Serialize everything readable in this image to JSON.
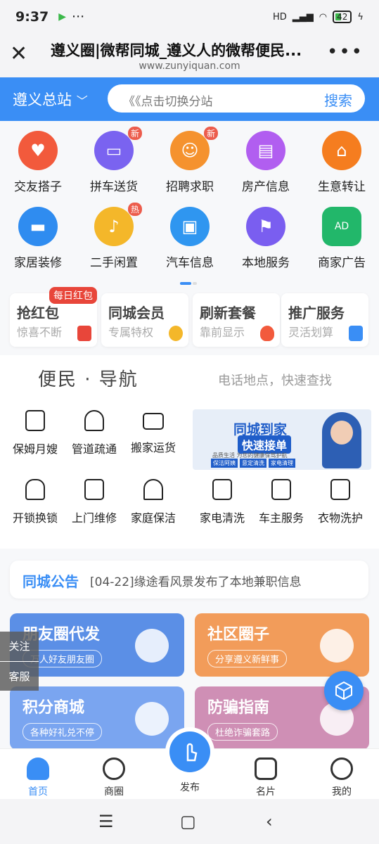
{
  "status": {
    "time": "9:37",
    "network": "HD",
    "battery": "42"
  },
  "browser": {
    "title": "遵义圈|微帮同城_遵义人的微帮便民...",
    "url": "www.zunyiquan.com"
  },
  "city": {
    "name": "遵义总站",
    "search_placeholder": "《《点击切换分站",
    "search_button": "搜索"
  },
  "categories": [
    {
      "label": "交友搭子",
      "color": "#f25a3c",
      "icon": "heart-handshake-icon"
    },
    {
      "label": "拼车送货",
      "color": "#7a63f0",
      "icon": "car-icon",
      "badge": "新"
    },
    {
      "label": "招聘求职",
      "color": "#f5922e",
      "icon": "person-tie-icon",
      "badge": "新"
    },
    {
      "label": "房产信息",
      "color": "#b15ef0",
      "icon": "building-icon"
    },
    {
      "label": "生意转让",
      "color": "#f57d1f",
      "icon": "shop-icon"
    },
    {
      "label": "家居装修",
      "color": "#2f8cf0",
      "icon": "sofa-icon"
    },
    {
      "label": "二手闲置",
      "color": "#f4b72a",
      "icon": "guitar-icon",
      "badge": "热"
    },
    {
      "label": "汽车信息",
      "color": "#2f96f0",
      "icon": "jeep-icon"
    },
    {
      "label": "本地服务",
      "color": "#7a5ef0",
      "icon": "location-flag-icon"
    },
    {
      "label": "商家广告",
      "color": "#22b76a",
      "icon": "ad-icon"
    }
  ],
  "promos": [
    {
      "title": "抢红包",
      "sub": "惊喜不断",
      "color": "#e8463a"
    },
    {
      "title": "同城会员",
      "sub": "专属特权",
      "color": "#f4b72a"
    },
    {
      "title": "刷新套餐",
      "sub": "靠前显示",
      "color": "#f25a3c"
    },
    {
      "title": "推广服务",
      "sub": "灵活划算",
      "color": "#3a8ef5"
    }
  ],
  "promo_badge": "每日红包",
  "nav": {
    "title": "便民 · 导航",
    "subtitle": "电话地点，快速查找",
    "items": [
      {
        "label": "保姆月嫂",
        "icon": "phone-icon"
      },
      {
        "label": "管道疏通",
        "icon": "pipe-icon"
      },
      {
        "label": "搬家运货",
        "icon": "truck-icon"
      },
      {
        "label": "开锁换锁",
        "icon": "lock-icon"
      },
      {
        "label": "上门维修",
        "icon": "fridge-icon"
      },
      {
        "label": "家庭保洁",
        "icon": "house-clean-icon"
      },
      {
        "label": "家电清洗",
        "icon": "phone-icon"
      },
      {
        "label": "车主服务",
        "icon": "phone-icon"
      },
      {
        "label": "衣物洗护",
        "icon": "phone-icon"
      }
    ],
    "ad": {
      "title": "同城到家",
      "badge": "快速接单",
      "line": "品质生活 为您的健康保驾护航",
      "tags": [
        "保洁阿姨",
        "意定清洗",
        "家电清理"
      ]
    }
  },
  "notice": {
    "label": "同城公告",
    "text": "[04-22]缘途看风景发布了本地兼职信息"
  },
  "cards": [
    {
      "title": "朋友圈代发",
      "sub": "万人好友朋友圈",
      "color": "#5b8fe6",
      "icon": "wechat-icon"
    },
    {
      "title": "社区圈子",
      "sub": "分享遵义新鲜事",
      "color": "#f29c5a",
      "icon": "swirl-icon"
    },
    {
      "title": "积分商城",
      "sub": "各种好礼兑不停",
      "color": "#7aa5f0",
      "icon": "coins-icon"
    },
    {
      "title": "防骗指南",
      "sub": "杜绝诈骗套路",
      "color": "#cf8fb5",
      "icon": "compass-icon"
    }
  ],
  "side": {
    "follow": "关注",
    "service": "客服"
  },
  "tabs": [
    {
      "label": "首页",
      "icon": "home-icon"
    },
    {
      "label": "商圈",
      "icon": "target-icon"
    },
    {
      "label": "发布",
      "icon": "tap-icon"
    },
    {
      "label": "名片",
      "icon": "card-icon"
    },
    {
      "label": "我的",
      "icon": "smile-icon"
    }
  ]
}
